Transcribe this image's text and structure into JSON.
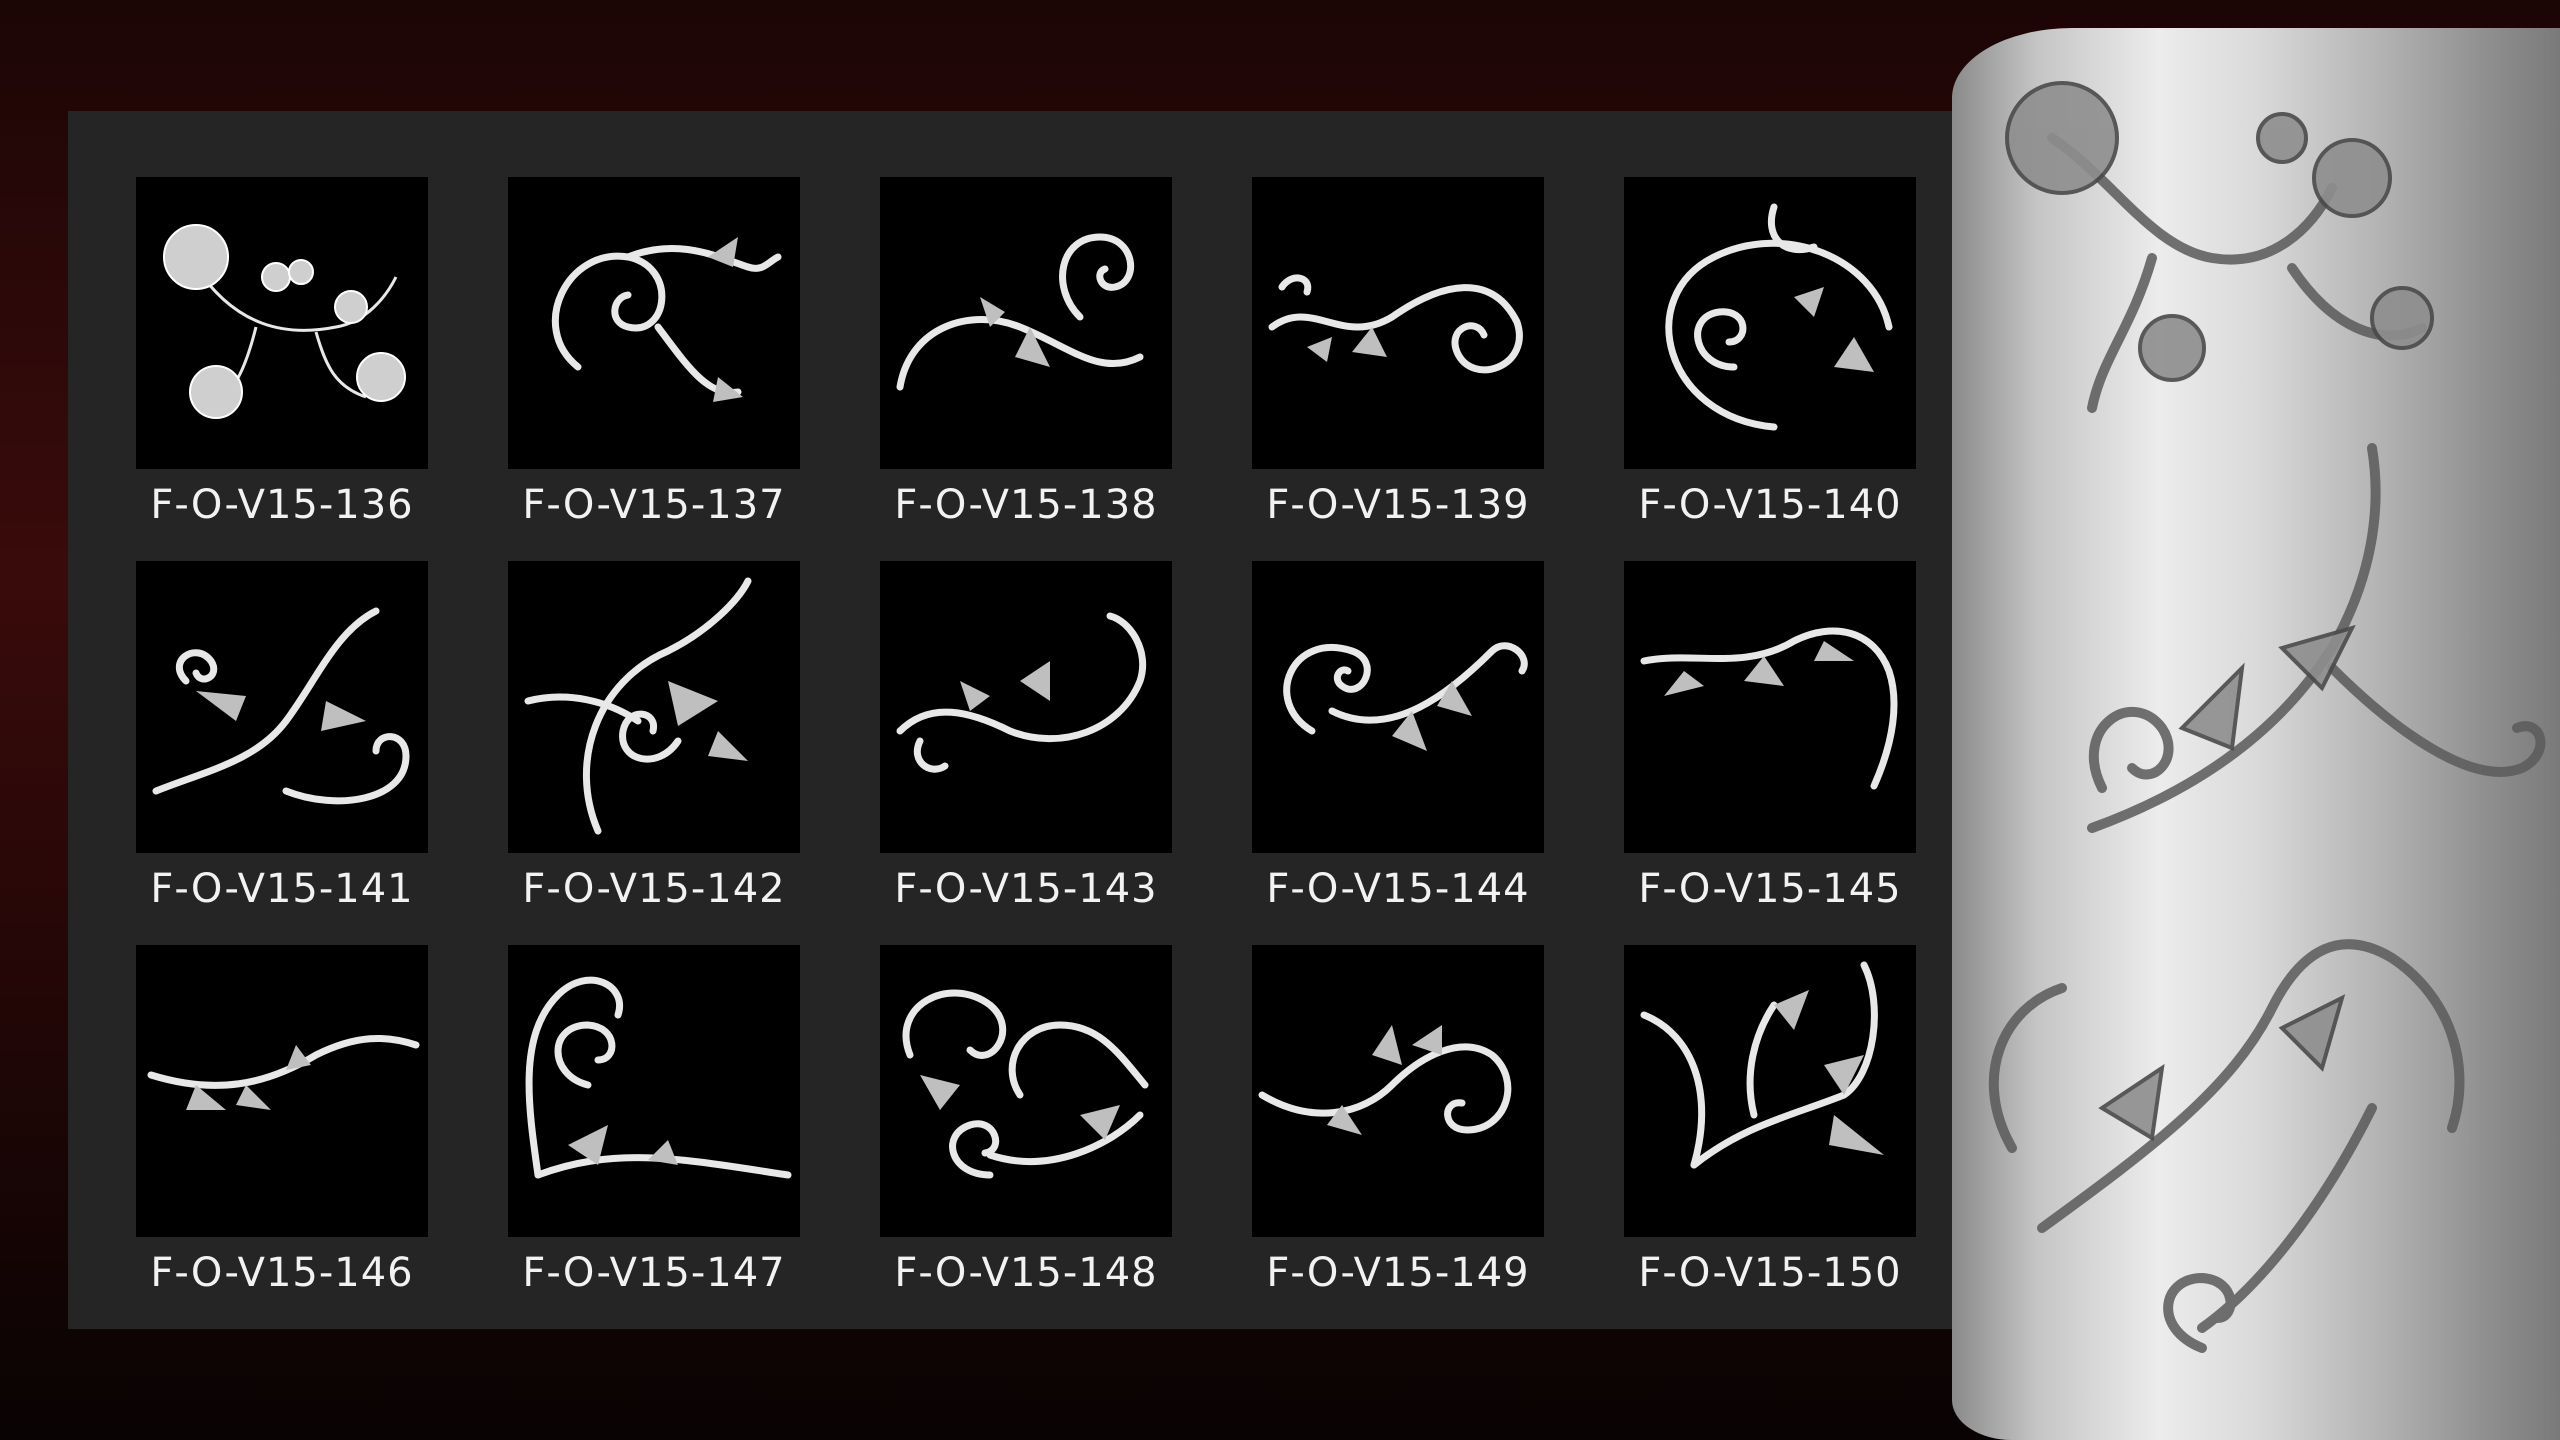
{
  "gallery": {
    "items": [
      {
        "code": "F-O-V15-136",
        "motif": "floral-cluster-icon"
      },
      {
        "code": "F-O-V15-137",
        "motif": "acanthus-scroll-icon"
      },
      {
        "code": "F-O-V15-138",
        "motif": "acanthus-scroll-icon"
      },
      {
        "code": "F-O-V15-139",
        "motif": "acanthus-scroll-icon"
      },
      {
        "code": "F-O-V15-140",
        "motif": "acanthus-scroll-icon"
      },
      {
        "code": "F-O-V15-141",
        "motif": "acanthus-scroll-icon"
      },
      {
        "code": "F-O-V15-142",
        "motif": "acanthus-scroll-icon"
      },
      {
        "code": "F-O-V15-143",
        "motif": "acanthus-scroll-icon"
      },
      {
        "code": "F-O-V15-144",
        "motif": "acanthus-scroll-icon"
      },
      {
        "code": "F-O-V15-145",
        "motif": "acanthus-scroll-icon"
      },
      {
        "code": "F-O-V15-146",
        "motif": "acanthus-scroll-icon"
      },
      {
        "code": "F-O-V15-147",
        "motif": "acanthus-scroll-icon"
      },
      {
        "code": "F-O-V15-148",
        "motif": "acanthus-scroll-icon"
      },
      {
        "code": "F-O-V15-149",
        "motif": "acanthus-scroll-icon"
      },
      {
        "code": "F-O-V15-150",
        "motif": "acanthus-scroll-icon"
      }
    ]
  },
  "preview": {
    "motif": "carved-cylinder-icon"
  },
  "colors": {
    "thumb_bg": "#000000",
    "panel_bg": "#252525",
    "label_text": "#f2f2f2",
    "ornament": "#e6e6e6"
  }
}
